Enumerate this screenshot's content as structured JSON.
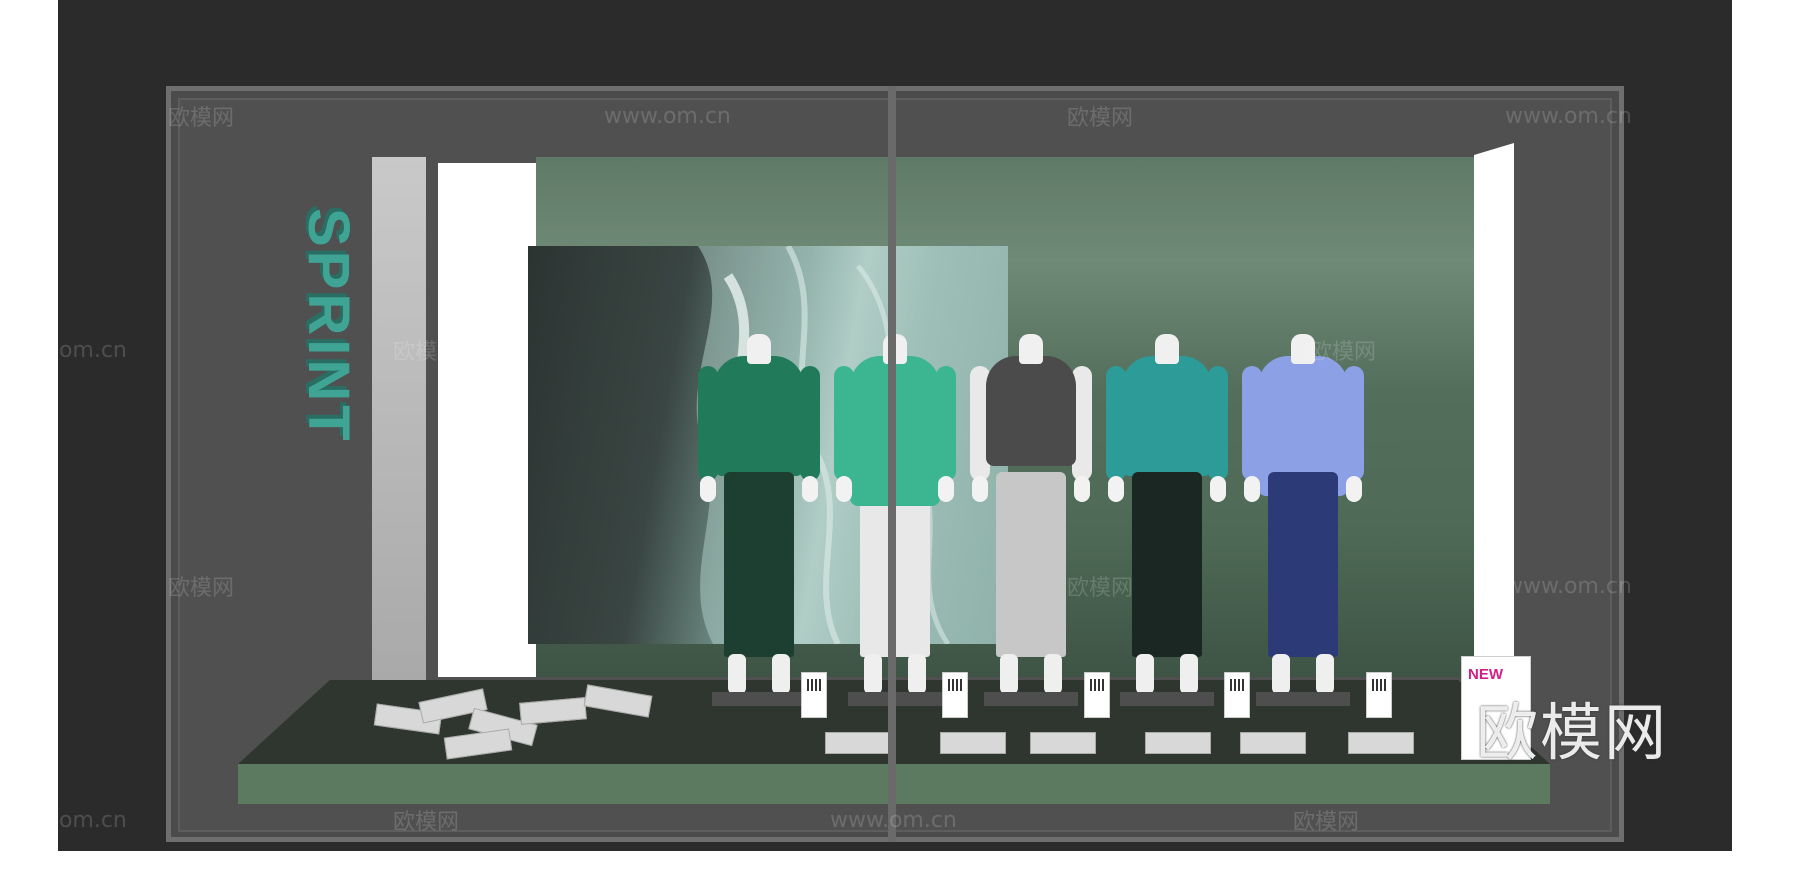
{
  "storefront": {
    "brand_sign": "SPRINT",
    "poster_title": "NEW",
    "watermark_logo": "欧模网",
    "watermark_url": "www.om.cn"
  },
  "colors": {
    "frame": "#2b2b2b",
    "back_wall": "#5f7a66",
    "brand": "#3fa494",
    "floor": "#2f362f",
    "accent_pink": "#d21f86"
  },
  "mannequins": [
    {
      "top": "#217a5a",
      "pants": "#1c3f31"
    },
    {
      "top": "#3cb591",
      "pants": "#e8e8e8"
    },
    {
      "top": "#4b4b4b",
      "pants": "#c7c7c7"
    },
    {
      "top": "#2d9b98",
      "pants": "#1a2722"
    },
    {
      "top": "#8ca0e6",
      "pants": "#2c3b78"
    }
  ]
}
